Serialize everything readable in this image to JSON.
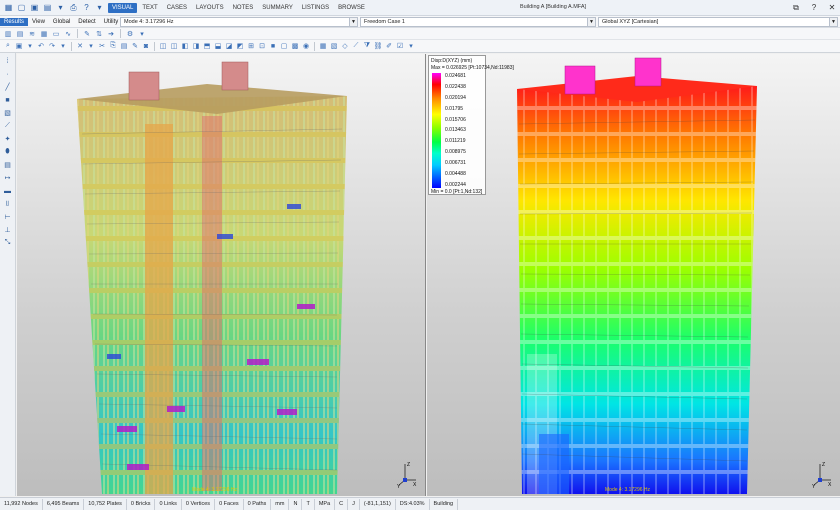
{
  "titlebar": {
    "app_title": "Building A [Building A.MFA]",
    "ribbon_tabs": [
      "VISUAL",
      "TEXT",
      "CASES",
      "LAYOUTS",
      "NOTES",
      "SUMMARY",
      "LISTINGS",
      "BROWSE"
    ],
    "active_tab": "VISUAL"
  },
  "menubar": {
    "items": [
      "Results",
      "View",
      "Global",
      "Detect",
      "Utility"
    ],
    "active": "Results",
    "mode_combo": "Mode 4: 3.17296 Hz",
    "case_combo": "Freedom Case 1",
    "coord_combo": "Global XYZ [Cartesian]"
  },
  "legend": {
    "title": "Disp:D(XYZ)  (mm)",
    "max": "Max = 0.026925 [Pt:10734,Nd:11983]",
    "ticks": [
      "0.024681",
      "0.022438",
      "0.020194",
      "0.01795",
      "0.015706",
      "0.013463",
      "0.011219",
      "0.008975",
      "0.006731",
      "0.004488",
      "0.002244"
    ],
    "min": "Min = 0.0 [Pt:1,Nd:132]"
  },
  "viewports": {
    "left_caption": "Mode 4: 3.17296 Hz",
    "right_caption": "Mode 4: 3.17296 Hz"
  },
  "axes": {
    "x": "X",
    "y": "Y",
    "z": "Z"
  },
  "statusbar": {
    "items": [
      "11,992 Nodes",
      "6,495 Beams",
      "10,752 Plates",
      "0 Bricks",
      "0 Links",
      "0 Vertices",
      "0 Faces",
      "0 Paths",
      "mm",
      "N",
      "T",
      "MPa",
      "C",
      "J",
      "(-81,1,151)",
      "DS:4.03%",
      "Building"
    ]
  },
  "colors": {
    "accent": "#2e6fc4"
  }
}
